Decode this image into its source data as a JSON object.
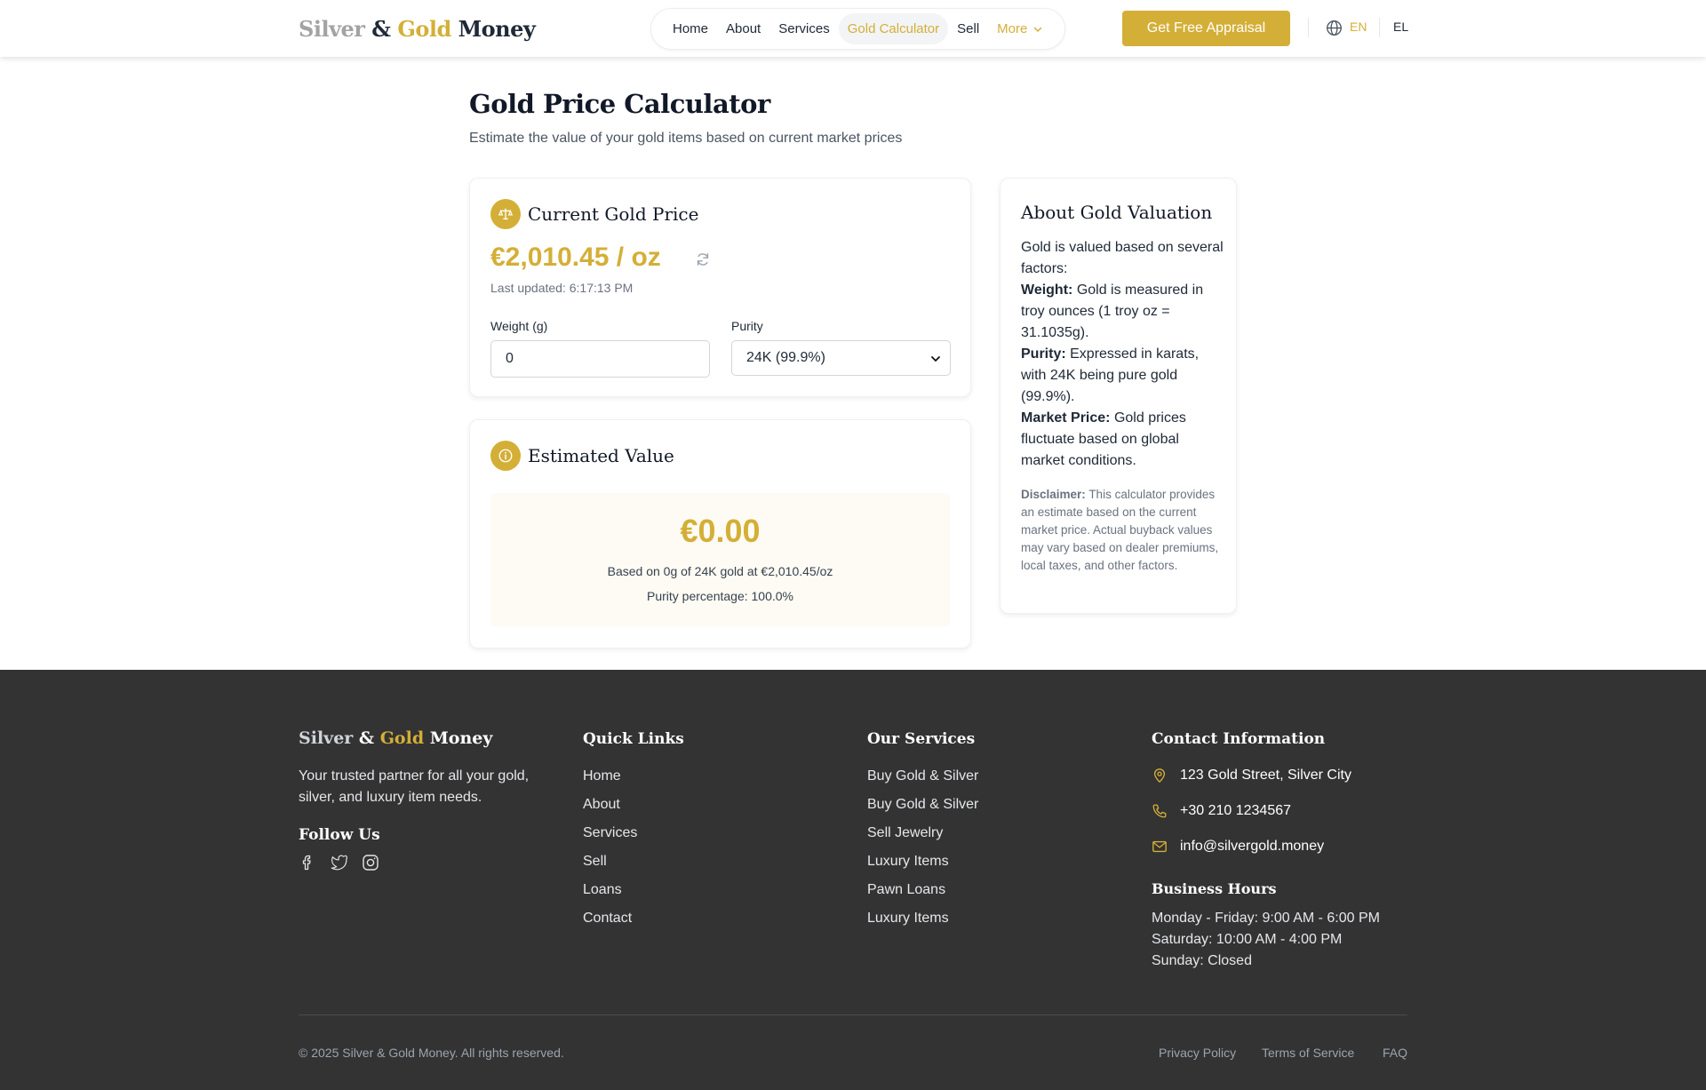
{
  "brand": {
    "silver": "Silver",
    "amp": "&",
    "gold": "Gold",
    "money": "Money"
  },
  "nav": {
    "items": [
      "Home",
      "About",
      "Services",
      "Gold Calculator",
      "Sell"
    ],
    "more": "More",
    "active": "Gold Calculator",
    "cta": "Get Free Appraisal",
    "lang_en": "EN",
    "lang_el": "EL"
  },
  "page": {
    "title": "Gold Price Calculator",
    "subtitle": "Estimate the value of your gold items based on current market prices"
  },
  "current_price": {
    "title": "Current Gold Price",
    "price": "€2,010.45 / oz",
    "updated": "Last updated: 6:17:13 PM",
    "weight_label": "Weight (g)",
    "weight_value": "0",
    "purity_label": "Purity",
    "purity_value": "24K (99.9%)"
  },
  "estimate": {
    "title": "Estimated Value",
    "amount": "€0.00",
    "basis": "Based on 0g of 24K gold at €2,010.45/oz",
    "purity_pct": "Purity percentage: 100.0%"
  },
  "about": {
    "title": "About Gold Valuation",
    "intro": "Gold is valued based on several factors:",
    "weight_term": "Weight:",
    "weight_text": "Gold is measured in troy ounces (1 troy oz = 31.1035g).",
    "purity_term": "Purity:",
    "purity_text": "Expressed in karats, with 24K being pure gold (99.9%).",
    "market_term": "Market Price:",
    "market_text": "Gold prices fluctuate based on global market conditions.",
    "disclaimer_term": "Disclaimer:",
    "disclaimer_text": "This calculator provides an estimate based on the current market price. Actual buyback values may vary based on dealer premiums, local taxes, and other factors."
  },
  "footer": {
    "tagline": "Your trusted partner for all your gold, silver, and luxury item needs.",
    "follow": "Follow Us",
    "quick_links_title": "Quick Links",
    "quick_links": [
      "Home",
      "About",
      "Services",
      "Sell",
      "Loans",
      "Contact"
    ],
    "services_title": "Our Services",
    "services": [
      "Buy Gold & Silver",
      "Buy Gold & Silver",
      "Sell Jewelry",
      "Luxury Items",
      "Pawn Loans",
      "Luxury Items"
    ],
    "contact_title": "Contact Information",
    "address": "123 Gold Street, Silver City",
    "phone": "+30 210 1234567",
    "email": "info@silvergold.money",
    "hours_title": "Business Hours",
    "hours": [
      "Monday - Friday: 9:00 AM - 6:00 PM",
      "Saturday: 10:00 AM - 4:00 PM",
      "Sunday: Closed"
    ],
    "copyright": "© 2025 Silver & Gold Money. All rights reserved.",
    "legal": [
      "Privacy Policy",
      "Terms of Service",
      "FAQ"
    ]
  },
  "colors": {
    "accent": "#d4af37",
    "footer_bg": "#333333",
    "text": "#1f2937"
  }
}
